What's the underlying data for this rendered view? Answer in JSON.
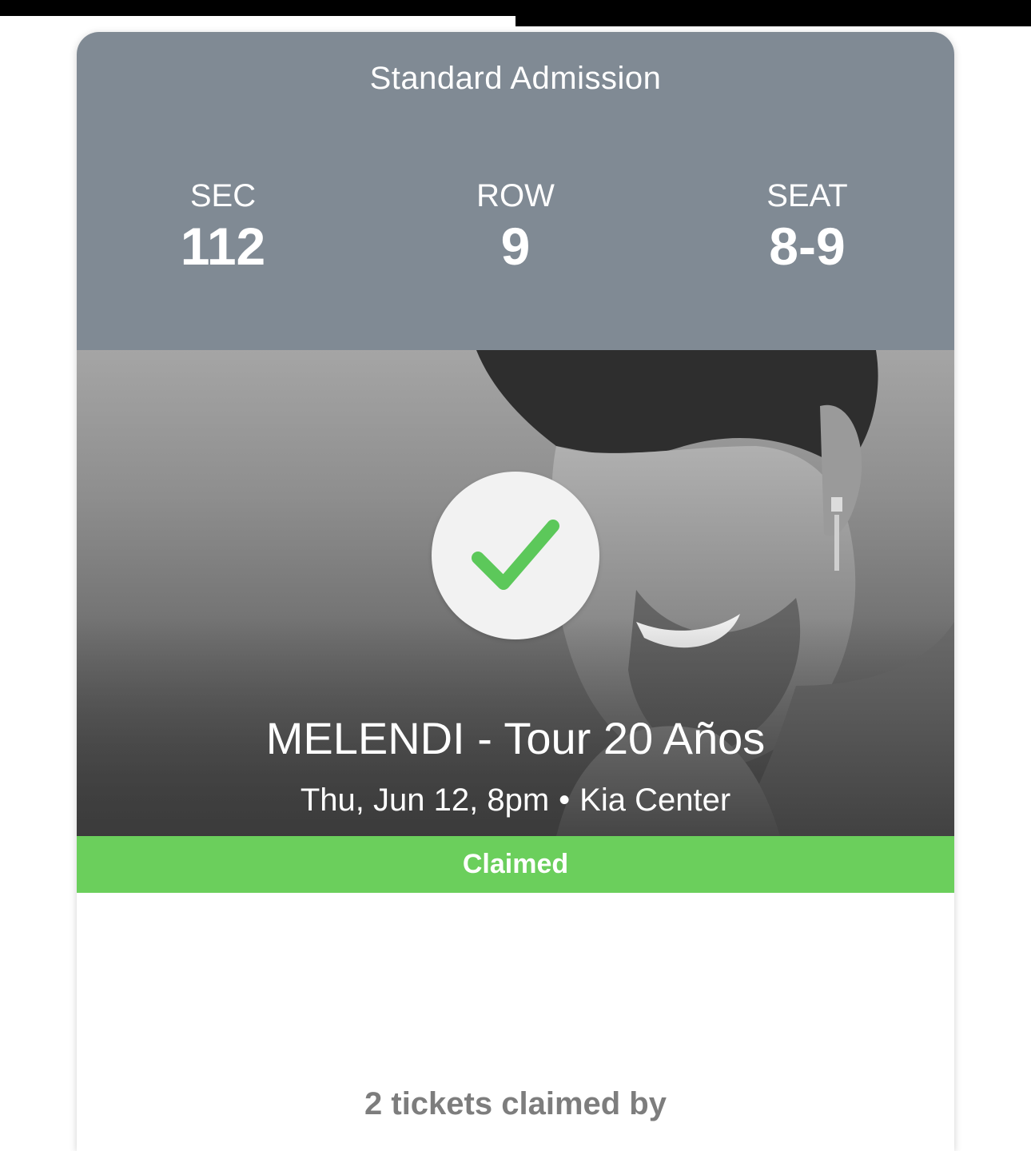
{
  "ticket": {
    "admission": "Standard Admission",
    "section": {
      "label": "SEC",
      "value": "112"
    },
    "row": {
      "label": "ROW",
      "value": "9"
    },
    "seat": {
      "label": "SEAT",
      "value": "8-9"
    }
  },
  "event": {
    "title": "MELENDI - Tour 20 Años",
    "date": "Thu, Jun 12, 8pm",
    "separator": "•",
    "venue": "Kia Center"
  },
  "status": {
    "label": "Claimed",
    "color": "#6bcf5c",
    "icon": "checkmark-icon"
  },
  "claim_info": {
    "text": "2 tickets claimed by"
  },
  "colors": {
    "header_bg": "#808a94",
    "check": "#5cc85a"
  }
}
